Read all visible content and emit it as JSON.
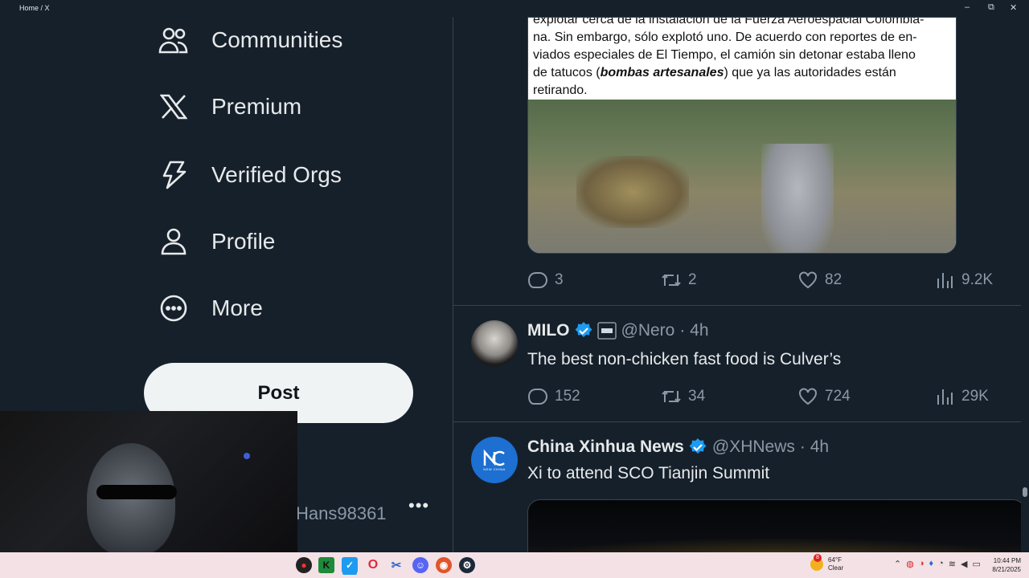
{
  "window": {
    "title": "Home / X"
  },
  "sidebar": {
    "items": [
      {
        "label": "Communities",
        "icon": "communities-icon"
      },
      {
        "label": "Premium",
        "icon": "x-logo-icon"
      },
      {
        "label": "Verified Orgs",
        "icon": "lightning-icon"
      },
      {
        "label": "Profile",
        "icon": "person-icon"
      },
      {
        "label": "More",
        "icon": "more-circle-icon"
      }
    ],
    "post_label": "Post",
    "account_handle": "Hans98361",
    "account_more": "•••"
  },
  "feed": {
    "tweet1": {
      "article_lines": [
        "explotar cerca de la instalación de la Fuerza Aeroespacial Colombia-",
        "na. Sin embargo, sólo explotó uno. De acuerdo con reportes de en-",
        "viados especiales de El Tiempo, el camión sin detonar estaba lleno",
        "retirando."
      ],
      "article_line4_pre": "de tatucos (",
      "article_line4_bold": "bombas artesanales",
      "article_line4_post": ") que ya las autoridades están",
      "replies": "3",
      "reposts": "2",
      "likes": "82",
      "views": "9.2K"
    },
    "tweet2": {
      "name": "MILO",
      "handle": "@Nero",
      "time": "· 4h",
      "text": "The best non-chicken fast food is Culver’s",
      "replies": "152",
      "reposts": "34",
      "likes": "724",
      "views": "29K"
    },
    "tweet3": {
      "name": "China Xinhua News",
      "handle": "@XHNews",
      "time": "· 4h",
      "text": "Xi to attend SCO Tianjin Summit",
      "avatar_text": "NEW CHINA"
    }
  },
  "taskbar": {
    "weather_temp": "64°F",
    "weather_cond": "Clear",
    "weather_badge": "8",
    "time": "10:44 PM",
    "date": "8/21/2025"
  },
  "colors": {
    "background": "#15202b",
    "accent": "#1d9bf0",
    "muted": "#8b98a5",
    "text": "#e7e9ea"
  }
}
